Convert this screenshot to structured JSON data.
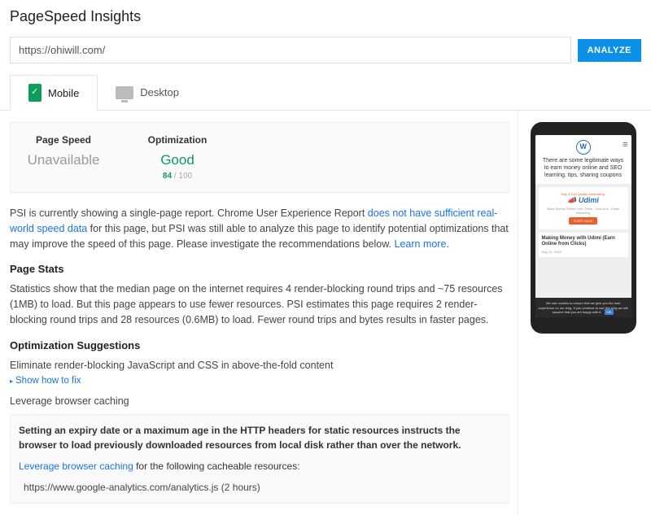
{
  "page_title": "PageSpeed Insights",
  "url_input": "https://ohiwill.com/",
  "analyze_label": "ANALYZE",
  "tabs": {
    "mobile": "Mobile",
    "desktop": "Desktop"
  },
  "metrics": {
    "page_speed": {
      "title": "Page Speed",
      "value": "Unavailable"
    },
    "optimization": {
      "title": "Optimization",
      "value": "Good",
      "score": "84",
      "total": " / 100"
    }
  },
  "intro": {
    "p1a": "PSI is currently showing a single-page report. Chrome User Experience Report ",
    "p1link": "does not have sufficient real-world speed data",
    "p1b": " for this page, but PSI was still able to analyze this page to identify potential optimizations that may improve the speed of this page. Please investigate the recommendations below. ",
    "learn": "Learn more"
  },
  "stats": {
    "heading": "Page Stats",
    "body": "Statistics show that the median page on the internet requires 4 render-blocking round trips and ~75 resources (1MB) to load. But this page appears to use fewer resources. PSI estimates this page requires 2 render-blocking round trips and 28 resources (0.6MB) to load. Fewer round trips and bytes results in faster pages."
  },
  "opt": {
    "heading": "Optimization Suggestions",
    "item1": "Eliminate render-blocking JavaScript and CSS in above-the-fold content",
    "show_fix": "Show how to fix",
    "item2": "Leverage browser caching",
    "cache_bold": "Setting an expiry date or a maximum age in the HTTP headers for static resources instructs the browser to load previously downloaded resources from local disk rather than over the network.",
    "cache_link": "Leverage browser caching",
    "cache_tail": " for the following cacheable resources:",
    "resource": "https://www.google-analytics.com/analytics.js (2 hours)"
  },
  "phone": {
    "title": "There are some legitimate ways to earn money online and SEO learning, tips, sharing coupons",
    "udimi_top": "Buy & Sell Quality Advertising",
    "udimi": "Udimi",
    "udimi_sub": "Make Money Online from Clicks - Solo Ads - Email Marketing",
    "udimi_btn": "START NOW",
    "post_title": "Making Money with Udimi (Earn Online from Clicks)",
    "post_date": "May 21, 2018",
    "cookie": "We use cookies to ensure that we give you the best experience on our blog. If you continue to use this blog we will assume that you are happy with it.",
    "ok": "OK"
  }
}
